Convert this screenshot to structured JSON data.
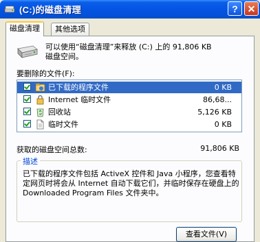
{
  "window": {
    "title": "(C:)的磁盘清理"
  },
  "title_buttons": {
    "help": "?",
    "close": "✕"
  },
  "tabs": [
    {
      "label": "磁盘清理",
      "active": true
    },
    {
      "label": "其他选项",
      "active": false
    }
  ],
  "intro": {
    "line1": "可以使用“磁盘清理”来释放 (C:) 上的 91,806 KB",
    "line2": "磁盘空间。"
  },
  "files_label": "要删除的文件(F):",
  "files": [
    {
      "name": "已下载的程序文件",
      "size": "0 KB",
      "checked": true,
      "selected": true,
      "icon": "downloaded-program-files-icon"
    },
    {
      "name": "Internet 临时文件",
      "size": "86,68...",
      "checked": true,
      "selected": false,
      "icon": "internet-temp-files-icon"
    },
    {
      "name": "回收站",
      "size": "5,126 KB",
      "checked": true,
      "selected": false,
      "icon": "recycle-bin-icon"
    },
    {
      "name": "临时文件",
      "size": "0 KB",
      "checked": true,
      "selected": false,
      "icon": "temp-files-icon"
    }
  ],
  "total": {
    "label": "获取的磁盘空间总数:",
    "value": "91,806 KB"
  },
  "description": {
    "group_label": "描述",
    "text": "已下载的程序文件包括 ActiveX 控件和 Java 小程序，您查看特定网页时将会从 Internet 自动下载它们，并临时保存在硬盘上的 Downloaded Program Files 文件夹中。"
  },
  "view_files_button": "查看文件(V)",
  "colors": {
    "titlebar": "#0554E3",
    "selection": "#316AC5",
    "dialog_bg": "#ECE9D8",
    "group_label": "#0046D5"
  }
}
